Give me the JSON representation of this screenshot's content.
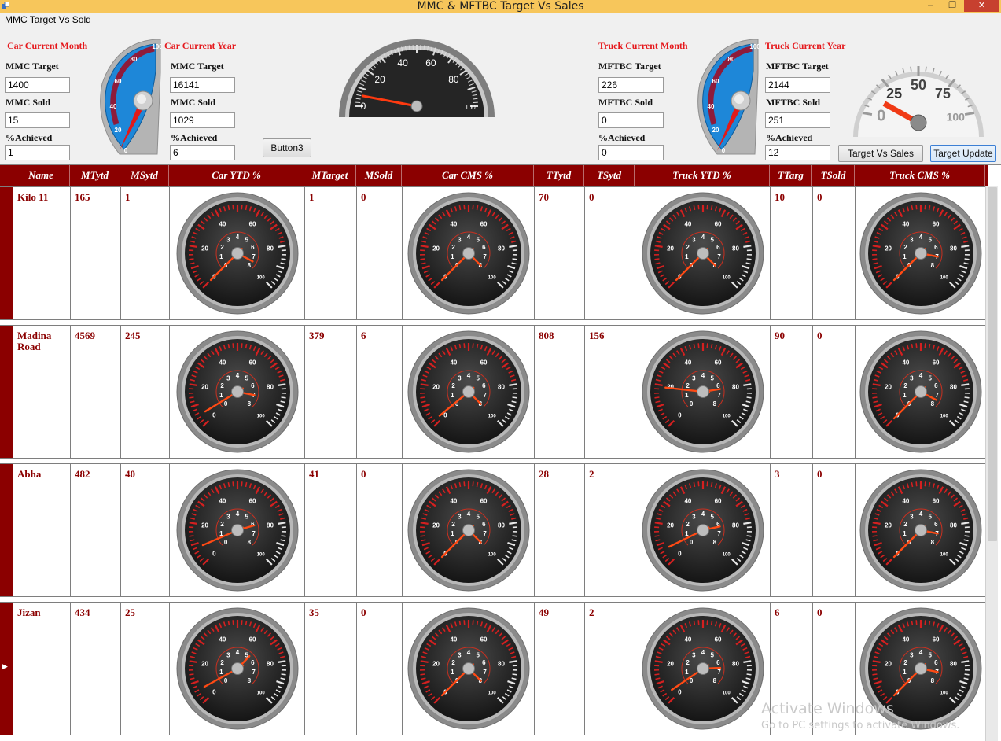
{
  "window": {
    "title": "MMC & MFTBC Target Vs Sales",
    "minimize": "–",
    "maximize": "❐",
    "close": "✕",
    "icon": "app-icon"
  },
  "group_caption": "MMC Target Vs Sold",
  "car_month": {
    "heading": "Car Current Month",
    "target_label": "MMC Target",
    "target": "1400",
    "sold_label": "MMC Sold",
    "sold": "15",
    "ach_label": "%Achieved",
    "ach": "1"
  },
  "car_year": {
    "heading": "Car Current Year",
    "target_label": "MMC Target",
    "target": "16141",
    "sold_label": "MMC Sold",
    "sold": "1029",
    "ach_label": "%Achieved",
    "ach": "6"
  },
  "truck_month": {
    "heading": "Truck Current Month",
    "target_label": "MFTBC Target",
    "target": "226",
    "sold_label": "MFTBC Sold",
    "sold": "0",
    "ach_label": "%Achieved",
    "ach": "0"
  },
  "truck_year": {
    "heading": "Truck Current Year",
    "target_label": "MFTBC Target",
    "target": "2144",
    "sold_label": "MFTBC Sold",
    "sold": "251",
    "ach_label": "%Achieved",
    "ach": "12"
  },
  "buttons": {
    "button3": "Button3",
    "target_vs_sales": "Target Vs Sales",
    "target_update": "Target Update"
  },
  "top_gauges": {
    "car_blue": {
      "ticks": [
        "0",
        "20",
        "40",
        "60",
        "80",
        "100"
      ],
      "value": 1
    },
    "center_dark": {
      "ticks": [
        "0",
        "20",
        "40",
        "60",
        "80",
        "100"
      ],
      "value": 6
    },
    "truck_blue": {
      "ticks": [
        "0",
        "20",
        "40",
        "60",
        "80",
        "100"
      ],
      "value": 0
    },
    "white": {
      "ticks": [
        "0",
        "25",
        "50",
        "75",
        "100"
      ],
      "value": 12
    }
  },
  "grid": {
    "columns": [
      "Name",
      "MTytd",
      "MSytd",
      "Car YTD %",
      "MTarget",
      "MSold",
      "Car CMS %",
      "TTytd",
      "TSytd",
      "Truck YTD %",
      "TTarg",
      "TSold",
      "Truck CMS %"
    ],
    "gauge_outer_ticks": [
      "0",
      "20",
      "40",
      "60",
      "80",
      "100"
    ],
    "gauge_inner_ticks": [
      "0",
      "1",
      "2",
      "3",
      "4",
      "5",
      "6",
      "7",
      "8"
    ],
    "rows": [
      {
        "name": "Kilo 11",
        "mtytd": "165",
        "msytd": "1",
        "mtarget": "1",
        "msold": "0",
        "ttytd": "70",
        "tsytd": "0",
        "ttarg": "10",
        "tsold": "0",
        "gauges": {
          "car_ytd": {
            "outer": 0,
            "inner": 7.5
          },
          "car_cms": {
            "outer": 0,
            "inner": 8
          },
          "truck_ytd": {
            "outer": 0,
            "inner": 8
          },
          "truck_cms": {
            "outer": 0,
            "inner": 7
          }
        }
      },
      {
        "name": "Madina Road",
        "mtytd": "4569",
        "msytd": "245",
        "mtarget": "379",
        "msold": "6",
        "ttytd": "808",
        "tsytd": "156",
        "ttarg": "90",
        "tsold": "0",
        "gauges": {
          "car_ytd": {
            "outer": 5,
            "inner": 7
          },
          "car_cms": {
            "outer": 2,
            "inner": 8
          },
          "truck_ytd": {
            "outer": 19,
            "inner": 6.4
          },
          "truck_cms": {
            "outer": 0,
            "inner": 7.5
          }
        }
      },
      {
        "name": "Abha",
        "mtytd": "482",
        "msytd": "40",
        "mtarget": "41",
        "msold": "0",
        "ttytd": "28",
        "tsytd": "2",
        "ttarg": "3",
        "tsold": "0",
        "gauges": {
          "car_ytd": {
            "outer": 8,
            "inner": 6.2
          },
          "car_cms": {
            "outer": 0,
            "inner": 8
          },
          "truck_ytd": {
            "outer": 7,
            "inner": 6.3
          },
          "truck_cms": {
            "outer": 0,
            "inner": 7
          }
        }
      },
      {
        "name": "Jizan",
        "mtytd": "434",
        "msytd": "25",
        "mtarget": "35",
        "msold": "0",
        "ttytd": "49",
        "tsytd": "2",
        "ttarg": "6",
        "tsold": "0",
        "gauges": {
          "car_ytd": {
            "outer": 6,
            "inner": 5.3
          },
          "car_cms": {
            "outer": 0,
            "inner": 8
          },
          "truck_ytd": {
            "outer": 4,
            "inner": 6.6
          },
          "truck_cms": {
            "outer": 0,
            "inner": 7
          }
        }
      }
    ]
  },
  "watermark": {
    "line1": "Activate Windows",
    "line2": "Go to PC settings to activate Windows."
  }
}
